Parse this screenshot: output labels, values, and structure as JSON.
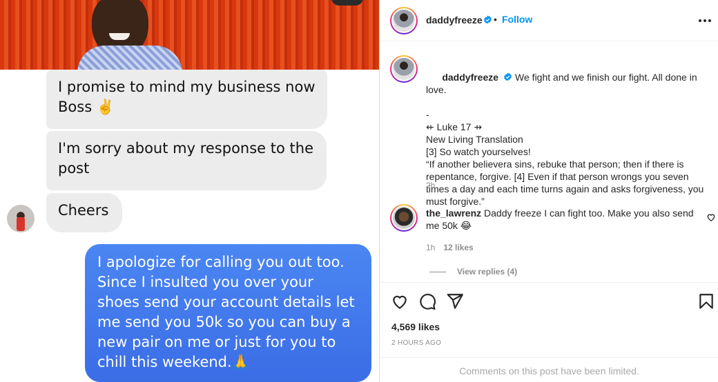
{
  "dm": {
    "messages": [
      {
        "text": "I promise to mind my business now Boss ✌️",
        "side": "incoming"
      },
      {
        "text": "I'm sorry about my response to the post",
        "side": "incoming"
      },
      {
        "text": "Cheers",
        "side": "incoming"
      },
      {
        "text": "I apologize for calling you out too. Since I insulted you over your shoes send your account details let me send you 50k so you can buy a new pair on me or just for you to chill this weekend.🙏",
        "side": "outgoing"
      }
    ]
  },
  "post": {
    "author": "daddyfreeze",
    "follow_label": "Follow",
    "separator": "•",
    "caption_lines": [
      "We fight and we finish our fight. All done in love.",
      "-",
      "⇷ Luke 17 ⇸",
      "New Living Translation",
      "[3] So watch yourselves!",
      "“If another believera sins, rebuke that person; then if there is repentance, forgive. [4] Even if that person wrongs you seven times a day and each time turns again and asks forgiveness, you must forgive.”"
    ],
    "caption_time": "2h",
    "comment": {
      "user": "the_lawrenz",
      "text": "Daddy freeze I can fight too. Make you also send me 50k 😂",
      "time": "1h",
      "likes": "12 likes",
      "view_replies": "View replies (4)"
    },
    "likes": "4,569 likes",
    "posted_ago": "2 HOURS AGO",
    "comments_limited": "Comments on this post have been limited."
  },
  "colors": {
    "accent": "#0095f6",
    "outgoing_bubble": "#3b6de6",
    "incoming_bubble": "#ececec"
  },
  "icons": [
    "verified-badge-icon",
    "more-options-icon",
    "heart-icon",
    "comment-icon",
    "share-icon",
    "bookmark-icon"
  ]
}
